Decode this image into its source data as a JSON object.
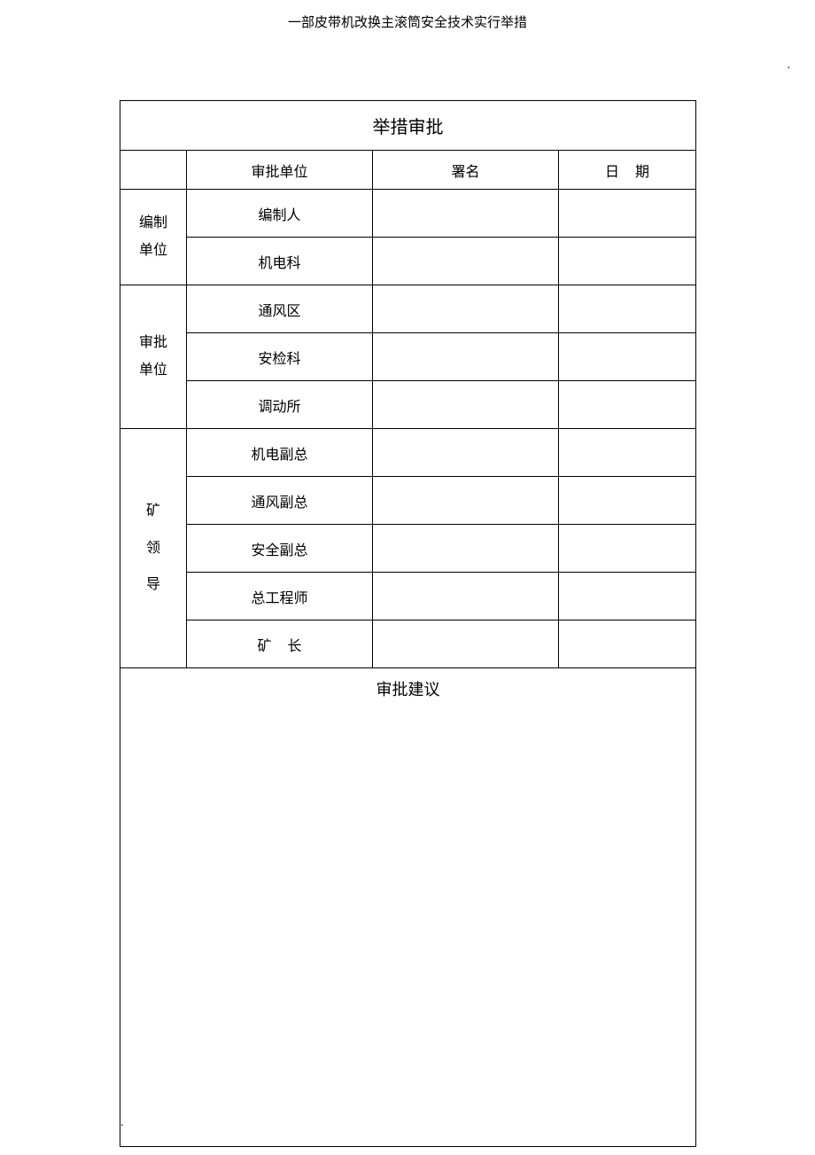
{
  "page_header": "一部皮带机改换主滚筒安全技术实行举措",
  "dot": ".",
  "table": {
    "title": "举措审批",
    "headers": {
      "unit": "审批单位",
      "sign": "署名",
      "date_char1": "日",
      "date_char2": "期"
    },
    "group1": {
      "label_line1": "编制",
      "label_line2": "单位",
      "rows": [
        "编制人",
        "机电科"
      ]
    },
    "group2": {
      "label_line1": "审批",
      "label_line2": "单位",
      "rows": [
        "通风区",
        "安检科",
        "调动所"
      ]
    },
    "group3": {
      "label_line1": "矿",
      "label_line2": "领",
      "label_line3": "导",
      "rows": [
        "机电副总",
        "通风副总",
        "安全副总",
        "总工程师"
      ],
      "last_c1": "矿",
      "last_c2": "长"
    },
    "suggestion": "审批建议"
  }
}
